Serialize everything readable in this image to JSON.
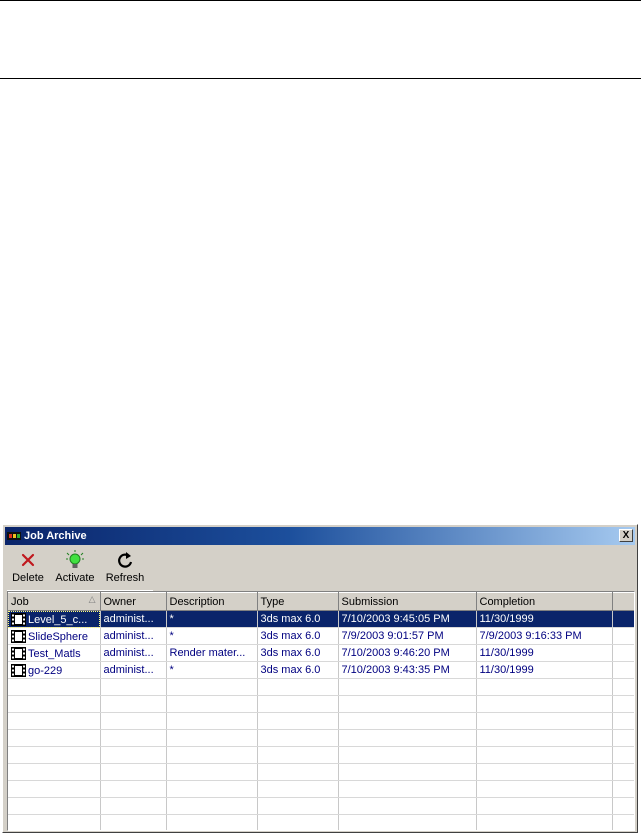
{
  "window": {
    "title": "Job Archive",
    "close_label": "X",
    "accent_color": "#0a246a"
  },
  "toolbar": {
    "delete_label": "Delete",
    "delete_icon": "x-icon",
    "activate_label": "Activate",
    "activate_icon": "lightbulb-icon",
    "refresh_label": "Refresh",
    "refresh_icon": "refresh-icon"
  },
  "table": {
    "columns": [
      "Job",
      "Owner",
      "Description",
      "Type",
      "Submission",
      "Completion"
    ],
    "sort_column": "Job",
    "rows": [
      {
        "job": "Level_5_c...",
        "owner": "administ...",
        "description": "*",
        "type": "3ds max 6.0",
        "submission": "7/10/2003 9:45:05 PM",
        "completion": "11/30/1999",
        "selected": true
      },
      {
        "job": "SlideSphere",
        "owner": "administ...",
        "description": "*",
        "type": "3ds max 6.0",
        "submission": "7/9/2003 9:01:57 PM",
        "completion": "7/9/2003 9:16:33 PM",
        "selected": false
      },
      {
        "job": "Test_Matls",
        "owner": "administ...",
        "description": "Render mater...",
        "type": "3ds max 6.0",
        "submission": "7/10/2003 9:46:20 PM",
        "completion": "11/30/1999",
        "selected": false
      },
      {
        "job": "go-229",
        "owner": "administ...",
        "description": "*",
        "type": "3ds max 6.0",
        "submission": "7/10/2003 9:43:35 PM",
        "completion": "11/30/1999",
        "selected": false
      }
    ]
  }
}
